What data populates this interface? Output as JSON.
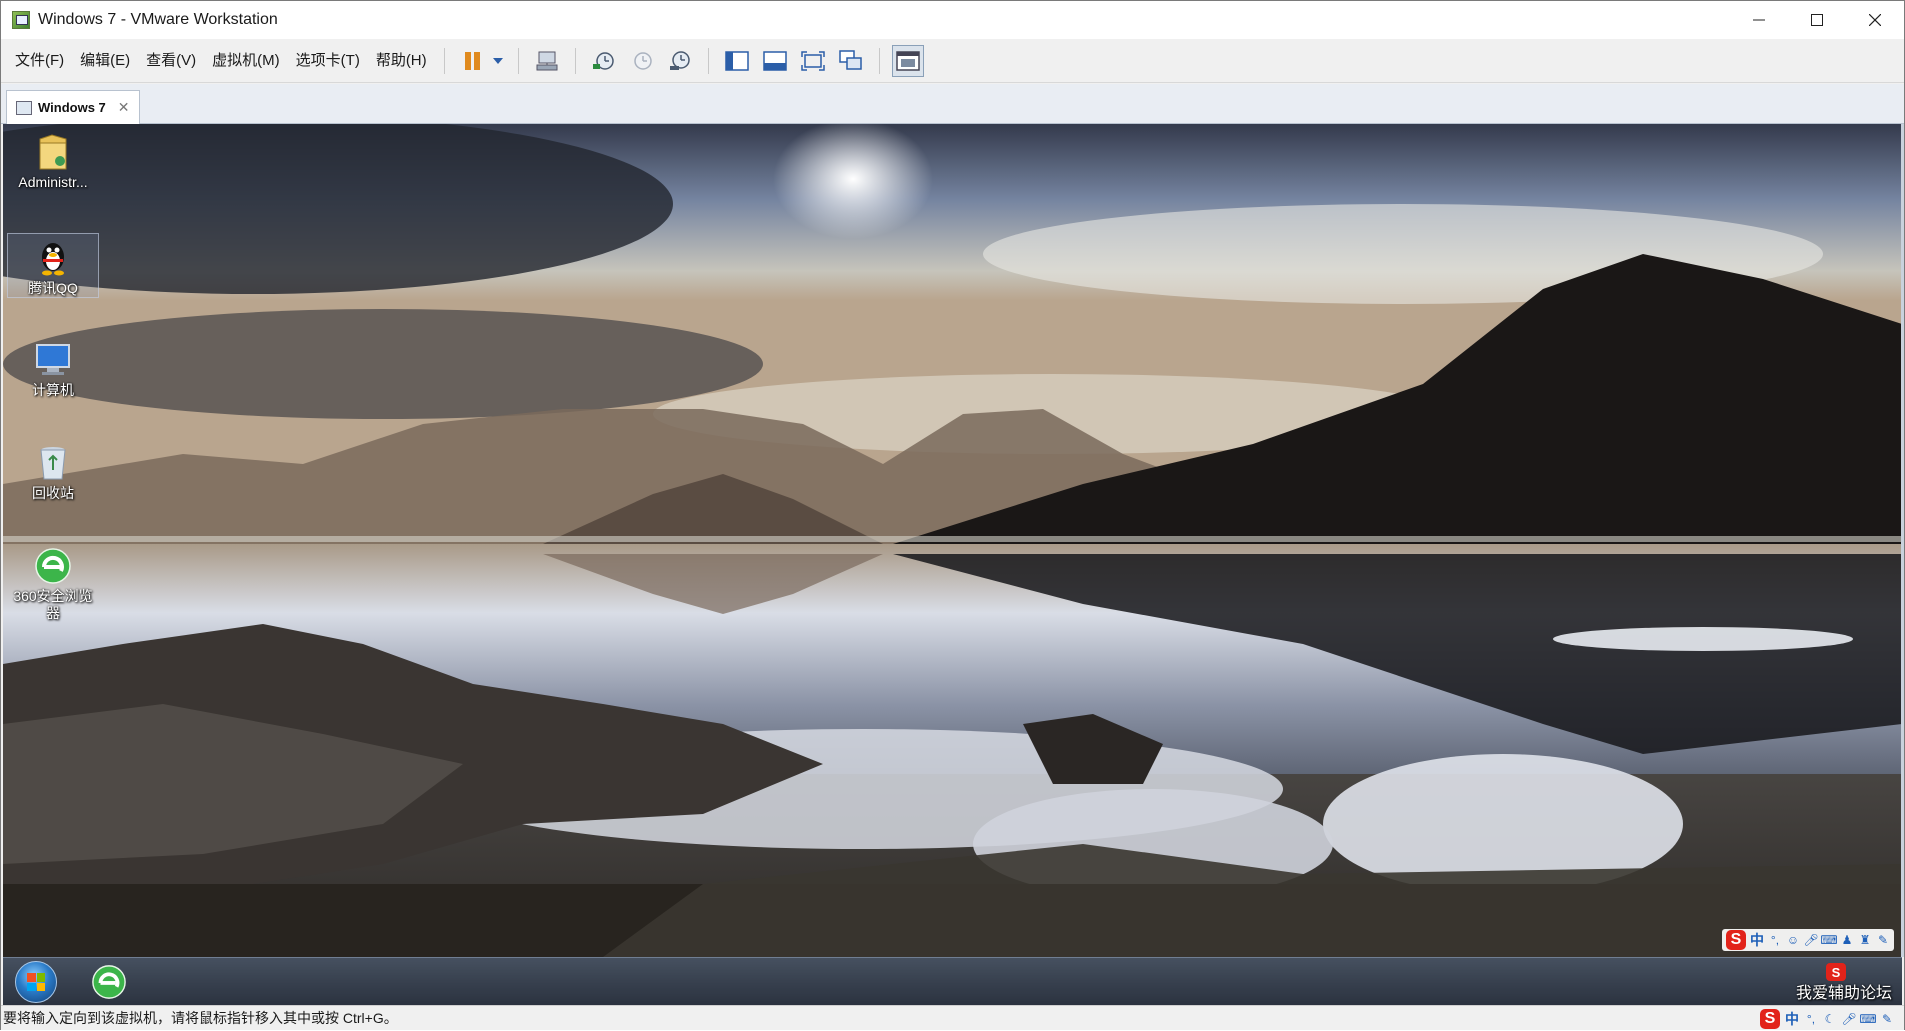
{
  "window": {
    "title": "Windows 7 - VMware Workstation",
    "controls": {
      "minimize": "─",
      "maximize": "☐",
      "close": "✕"
    }
  },
  "menu": {
    "items": [
      "文件(F)",
      "编辑(E)",
      "查看(V)",
      "虚拟机(M)",
      "选项卡(T)",
      "帮助(H)"
    ]
  },
  "toolbar": {
    "icons": [
      "pause-icon",
      "dropdown-icon",
      "send-ctrl-alt-del-icon",
      "snapshot-take-icon",
      "snapshot-revert-icon",
      "snapshot-manager-icon",
      "library-view-icon",
      "thumbnail-view-icon",
      "fullscreen-icon",
      "unity-icon",
      "console-view-icon"
    ],
    "accent": "#e08a1e"
  },
  "tabs": [
    {
      "label": "Windows 7",
      "close": "✕"
    }
  ],
  "desktop": {
    "icons": [
      {
        "label": "Administr...",
        "icon": "user-folder-icon"
      },
      {
        "label": "腾讯QQ",
        "icon": "qq-penguin-icon"
      },
      {
        "label": "计算机",
        "icon": "computer-icon"
      },
      {
        "label": "回收站",
        "icon": "recycle-bin-icon"
      },
      {
        "label": "360安全浏览器",
        "icon": "browser-360-icon"
      }
    ]
  },
  "guest_taskbar": {
    "start": "start-orb-icon",
    "pinned": [
      "browser-360-icon"
    ],
    "ime": {
      "logo": "S",
      "lang": "中"
    }
  },
  "watermark": {
    "text": "我爱辅助论坛",
    "logo": "S"
  },
  "status": {
    "text": "要将输入定向到该虚拟机，请将鼠标指针移入其中或按 Ctrl+G。",
    "ime": {
      "logo": "S",
      "lang": "中"
    }
  }
}
